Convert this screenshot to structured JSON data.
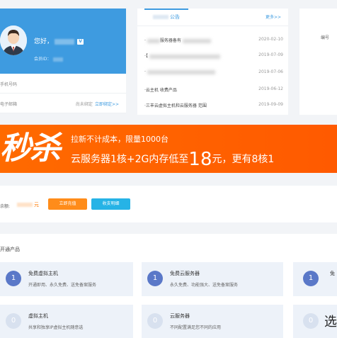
{
  "user": {
    "greeting": "您好，",
    "verified_badge": "V",
    "member_id_label": "会员ID："
  },
  "info": {
    "phone_label": "手机号码",
    "email_label": "电子邮箱",
    "email_status": "尚未绑定",
    "email_bind_link": "立即绑定>>"
  },
  "notice": {
    "tab_label": "公告",
    "more_link": "更多>>",
    "items": [
      {
        "prefix": "·",
        "title": "服务器备有",
        "date": "2020-02-10"
      },
      {
        "prefix": "·【",
        "title": "",
        "date": "2019-07-09"
      },
      {
        "prefix": "·",
        "title": "",
        "date": "2019-07-06"
      },
      {
        "prefix": "·",
        "title": "云主机 收费产品",
        "date": "2019-06-12"
      },
      {
        "prefix": "·",
        "title": "三丰云虚拟主机和云服务器  范围",
        "date": "2019-09-09"
      }
    ]
  },
  "right_card": {
    "label1": "",
    "label2": "编号"
  },
  "banner": {
    "big_text": "秒杀",
    "line1": "拉新不计成本，限量1000台",
    "line2_prefix": "云服务器1核+2G内存低至",
    "line2_number": "18",
    "line2_suffix": "元，更有8核1"
  },
  "balance": {
    "label": "余额:",
    "unit": "元",
    "recharge_button": "立即充值",
    "details_button": "收支明细"
  },
  "products": {
    "heading": "开通产品",
    "items": [
      {
        "count": "1",
        "name": "免费虚拟主机",
        "desc": "开通即用、永久免费、送免备案服务",
        "active": true
      },
      {
        "count": "1",
        "name": "免费云服务器",
        "desc": "永久免费、功能强大、送免备案服务",
        "active": true
      },
      {
        "count": "1",
        "name": "免",
        "desc": "",
        "active": true
      },
      {
        "count": "0",
        "name": "虚拟主机",
        "desc": "共享和独享IP虚拟主机随意选",
        "active": false
      },
      {
        "count": "0",
        "name": "云服务器",
        "desc": "不同配置满足您不同的应用",
        "active": false
      },
      {
        "count": "0",
        "name": "选",
        "desc": "",
        "active": false
      }
    ]
  },
  "colors": {
    "accent_blue": "#3e9be0",
    "banner_orange": "#ff6a00",
    "recharge_orange": "#ff8c1a",
    "details_cyan": "#26b3e6",
    "product_circle": "#5a78c8"
  }
}
